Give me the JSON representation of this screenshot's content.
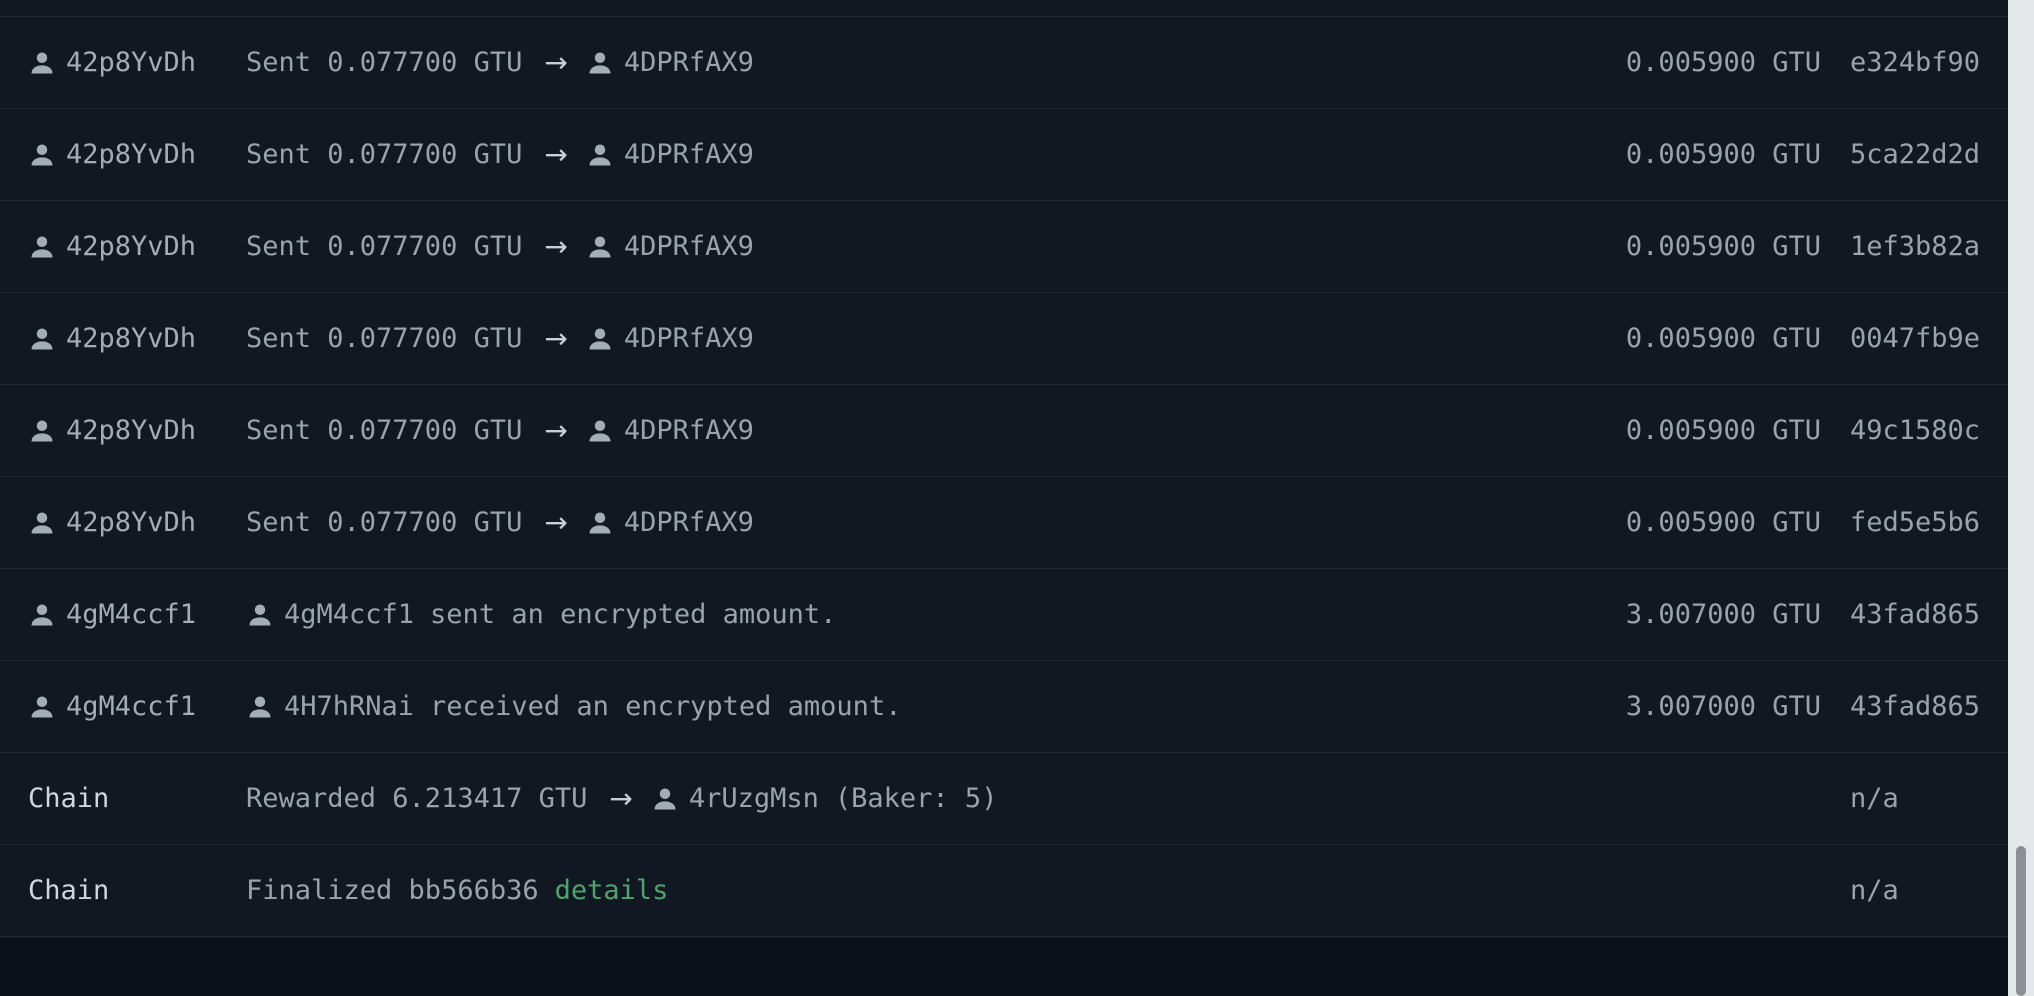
{
  "rows": [
    {
      "sender": "42p8YvDh",
      "event_prefix": "Sent 0.077700 GTU",
      "recipient": "4DPRfAX9",
      "cost": "0.005900 GTU",
      "hash": "e324bf90"
    },
    {
      "sender": "42p8YvDh",
      "event_prefix": "Sent 0.077700 GTU",
      "recipient": "4DPRfAX9",
      "cost": "0.005900 GTU",
      "hash": "5ca22d2d"
    },
    {
      "sender": "42p8YvDh",
      "event_prefix": "Sent 0.077700 GTU",
      "recipient": "4DPRfAX9",
      "cost": "0.005900 GTU",
      "hash": "1ef3b82a"
    },
    {
      "sender": "42p8YvDh",
      "event_prefix": "Sent 0.077700 GTU",
      "recipient": "4DPRfAX9",
      "cost": "0.005900 GTU",
      "hash": "0047fb9e"
    },
    {
      "sender": "42p8YvDh",
      "event_prefix": "Sent 0.077700 GTU",
      "recipient": "4DPRfAX9",
      "cost": "0.005900 GTU",
      "hash": "49c1580c"
    },
    {
      "sender": "42p8YvDh",
      "event_prefix": "Sent 0.077700 GTU",
      "recipient": "4DPRfAX9",
      "cost": "0.005900 GTU",
      "hash": "fed5e5b6"
    },
    {
      "sender": "4gM4ccf1",
      "account": "4gM4ccf1",
      "event_text": "sent an encrypted amount.",
      "cost": "3.007000 GTU",
      "hash": "43fad865"
    },
    {
      "sender": "4gM4ccf1",
      "account": "4H7hRNai",
      "event_text": "received an encrypted amount.",
      "cost": "3.007000 GTU",
      "hash": "43fad865"
    },
    {
      "sender": "Chain",
      "event_prefix": "Rewarded 6.213417 GTU",
      "recipient": "4rUzgMsn",
      "event_suffix": "(Baker: 5)",
      "hash": "n/a"
    },
    {
      "sender": "Chain",
      "event_prefix": "Finalized bb566b36",
      "link": "details",
      "hash": "n/a"
    }
  ],
  "icons": {
    "account": "person-icon",
    "arrow": "→"
  },
  "colors": {
    "background": "#111822",
    "text": "#9aa3ad",
    "link": "#4fa36d",
    "divider": "#1e2836"
  }
}
